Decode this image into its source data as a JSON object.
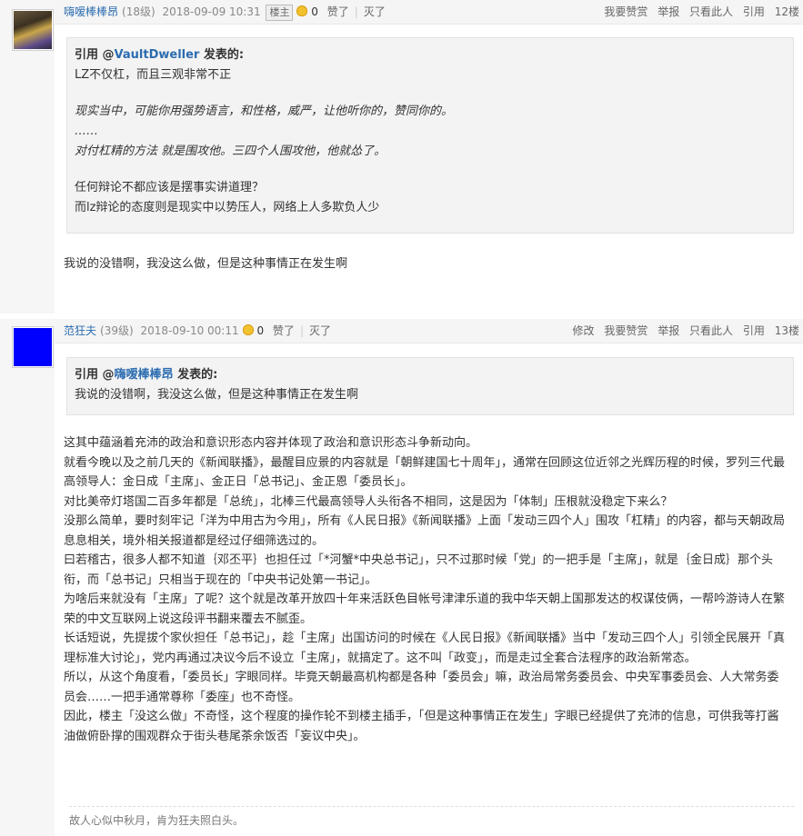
{
  "posts": [
    {
      "username": "嗨嗳棒棒昂",
      "level": "(18级)",
      "datetime": "2018-09-09 10:31",
      "owner_badge": "楼主",
      "likes": "0",
      "like_label": "赞了",
      "dislike_label": "灭了",
      "actions": [
        "我要赞赏",
        "举报",
        "只看此人",
        "引用"
      ],
      "floor": "12楼",
      "quote": {
        "prefix": "引用 @",
        "name": "VaultDweller",
        "suffix": " 发表的:",
        "lines": [
          "LZ不仅杠，而且三观非常不正",
          "",
          "现实当中，可能你用强势语言，和性格，威严，让他听你的，赞同你的。",
          "……",
          "对付杠精的方法 就是围攻他。三四个人围攻他，他就怂了。",
          "",
          "任何辩论不都应该是摆事实讲道理？",
          "而lz辩论的态度则是现实中以势压人，网络上人多欺负人少"
        ]
      },
      "content": [
        "我说的没错啊，我没这么做，但是这种事情正在发生啊"
      ]
    },
    {
      "username": "范狂夫",
      "level": "(39级)",
      "datetime": "2018-09-10 00:11",
      "likes": "0",
      "like_label": "赞了",
      "dislike_label": "灭了",
      "actions": [
        "修改",
        "我要赞赏",
        "举报",
        "只看此人",
        "引用"
      ],
      "floor": "13楼",
      "quote": {
        "prefix": "引用 @",
        "name": "嗨嗳棒棒昂",
        "suffix": " 发表的:",
        "lines": [
          "我说的没错啊，我没这么做，但是这种事情正在发生啊"
        ]
      },
      "content": [
        "这其中蕴涵着充沛的政治和意识形态内容并体现了政治和意识形态斗争新动向。",
        "就看今晚以及之前几天的《新闻联播》，最醒目应景的内容就是「朝鲜建国七十周年」，通常在回顾这位近邻之光辉历程的时候，罗列三代最高领导人：金日成「主席」、金正日「总书记」、金正恩「委员长」。",
        "对比美帝灯塔国二百多年都是「总统」，北棒三代最高领导人头衔各不相同，这是因为「体制」压根就没稳定下来么？",
        "没那么简单，要时刻牢记「洋为中用古为今用」，所有《人民日报》《新闻联播》上面「发动三四个人」围攻「杠精」的内容，都与天朝政局息息相关，境外相关报道都是经过仔细筛选过的。",
        "曰若稽古，很多人都不知道｛邓丕平｝也担任过「*河蟹*中央总书记」，只不过那时候「党」的一把手是「主席」，就是｛金日成｝那个头衔，而「总书记」只相当于现在的「中央书记处第一书记」。",
        "为啥后来就没有「主席」了呢？这个就是改革开放四十年来活跃色目帐号津津乐道的我中华天朝上国那发达的权谋伎俩，一帮吟游诗人在繁荣的中文互联网上说这段评书翻来覆去不腻歪。",
        "长话短说，先提拔个家伙担任「总书记」，趁「主席」出国访问的时候在《人民日报》《新闻联播》当中「发动三四个人」引领全民展开「真理标准大讨论」，党内再通过决议今后不设立「主席」，就搞定了。这不叫「政变」，而是走过全套合法程序的政治新常态。",
        "所以，从这个角度看，「委员长」字眼同样。毕竟天朝最高机构都是各种「委员会」嘛，政治局常务委员会、中央军事委员会、人大常务委员会……一把手通常尊称「委座」也不奇怪。",
        "因此，楼主「没这么做」不奇怪，这个程度的操作轮不到楼主插手，「但是这种事情正在发生」字眼已经提供了充沛的信息，可供我等打酱油做俯卧撑的围观群众于街头巷尾茶余饭否「妄议中央」。"
      ],
      "signature": "故人心似中秋月，肯为狂夫照白头。"
    }
  ]
}
